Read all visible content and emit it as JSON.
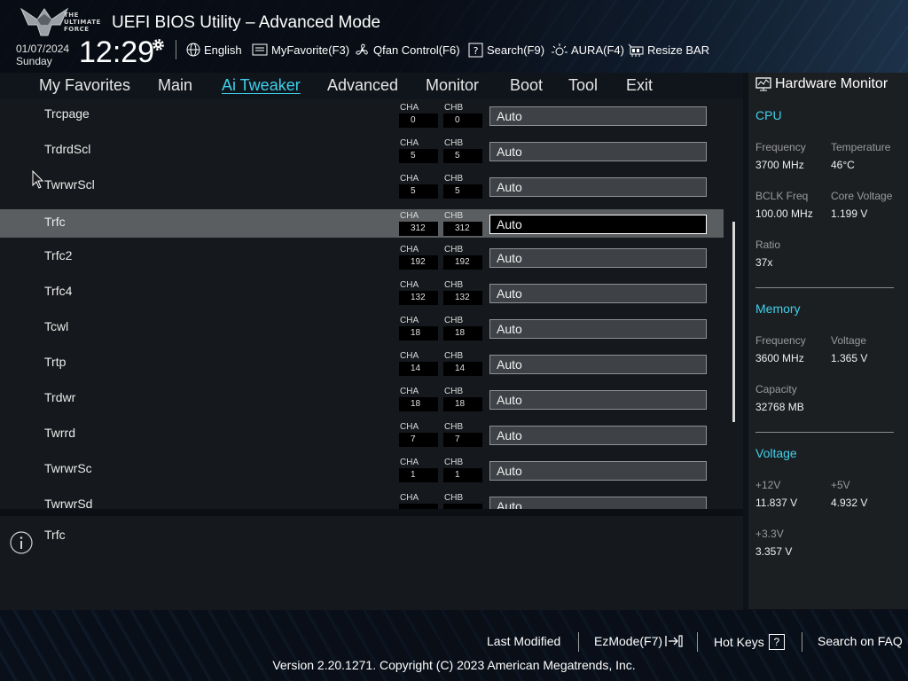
{
  "header": {
    "logo_lines": [
      "THE",
      "ULTIMATE",
      "FORCE"
    ],
    "title": "UEFI BIOS Utility – Advanced Mode",
    "date": "01/07/2024",
    "day": "Sunday",
    "time": "12:29",
    "items": [
      {
        "label": "English",
        "icon": "globe-icon"
      },
      {
        "label": "MyFavorite(F3)",
        "icon": "favorite-icon"
      },
      {
        "label": "Qfan Control(F6)",
        "icon": "fan-icon"
      },
      {
        "label": "Search(F9)",
        "icon": "search-icon"
      },
      {
        "label": "AURA(F4)",
        "icon": "aura-icon"
      },
      {
        "label": "Resize BAR",
        "icon": "resize-bar-icon"
      }
    ]
  },
  "nav": {
    "tabs": [
      "My Favorites",
      "Main",
      "Ai Tweaker",
      "Advanced",
      "Monitor",
      "Boot",
      "Tool",
      "Exit"
    ],
    "active": "Ai Tweaker"
  },
  "channels": {
    "a": "CHA",
    "b": "CHB"
  },
  "rows": [
    {
      "label": "Trcpage",
      "cha": "0",
      "chb": "0",
      "value": "Auto"
    },
    {
      "label": "TrdrdScl",
      "cha": "5",
      "chb": "5",
      "value": "Auto"
    },
    {
      "label": "TwrwrScl",
      "cha": "5",
      "chb": "5",
      "value": "Auto"
    },
    {
      "label": "Trfc",
      "cha": "312",
      "chb": "312",
      "value": "Auto",
      "selected": true
    },
    {
      "label": "Trfc2",
      "cha": "192",
      "chb": "192",
      "value": "Auto"
    },
    {
      "label": "Trfc4",
      "cha": "132",
      "chb": "132",
      "value": "Auto"
    },
    {
      "label": "Tcwl",
      "cha": "18",
      "chb": "18",
      "value": "Auto"
    },
    {
      "label": "Trtp",
      "cha": "14",
      "chb": "14",
      "value": "Auto"
    },
    {
      "label": "Trdwr",
      "cha": "18",
      "chb": "18",
      "value": "Auto"
    },
    {
      "label": "Twrrd",
      "cha": "7",
      "chb": "7",
      "value": "Auto"
    },
    {
      "label": "TwrwrSc",
      "cha": "1",
      "chb": "1",
      "value": "Auto"
    },
    {
      "label": "TwrwrSd",
      "cha": "",
      "chb": "",
      "value": "Auto"
    }
  ],
  "help": {
    "text": "Trfc"
  },
  "hardware_monitor": {
    "title": "Hardware Monitor",
    "cpu": {
      "heading": "CPU",
      "frequency_label": "Frequency",
      "frequency": "3700 MHz",
      "temperature_label": "Temperature",
      "temperature": "46°C",
      "bclk_label": "BCLK Freq",
      "bclk": "100.00 MHz",
      "core_voltage_label": "Core Voltage",
      "core_voltage": "1.199 V",
      "ratio_label": "Ratio",
      "ratio": "37x"
    },
    "memory": {
      "heading": "Memory",
      "frequency_label": "Frequency",
      "frequency": "3600 MHz",
      "voltage_label": "Voltage",
      "voltage": "1.365 V",
      "capacity_label": "Capacity",
      "capacity": "32768 MB"
    },
    "voltage": {
      "heading": "Voltage",
      "v12_label": "+12V",
      "v12": "11.837 V",
      "v5_label": "+5V",
      "v5": "4.932 V",
      "v33_label": "+3.3V",
      "v33": "3.357 V"
    }
  },
  "footer": {
    "last_modified": "Last Modified",
    "ezmode": "EzMode(F7)",
    "hot_keys": "Hot Keys",
    "hot_keys_badge": "?",
    "search_faq": "Search on FAQ",
    "copyright": "Version 2.20.1271. Copyright (C) 2023 American Megatrends, Inc."
  },
  "colors": {
    "accent": "#3fd0ea",
    "selected_row": "#5b5e61"
  }
}
